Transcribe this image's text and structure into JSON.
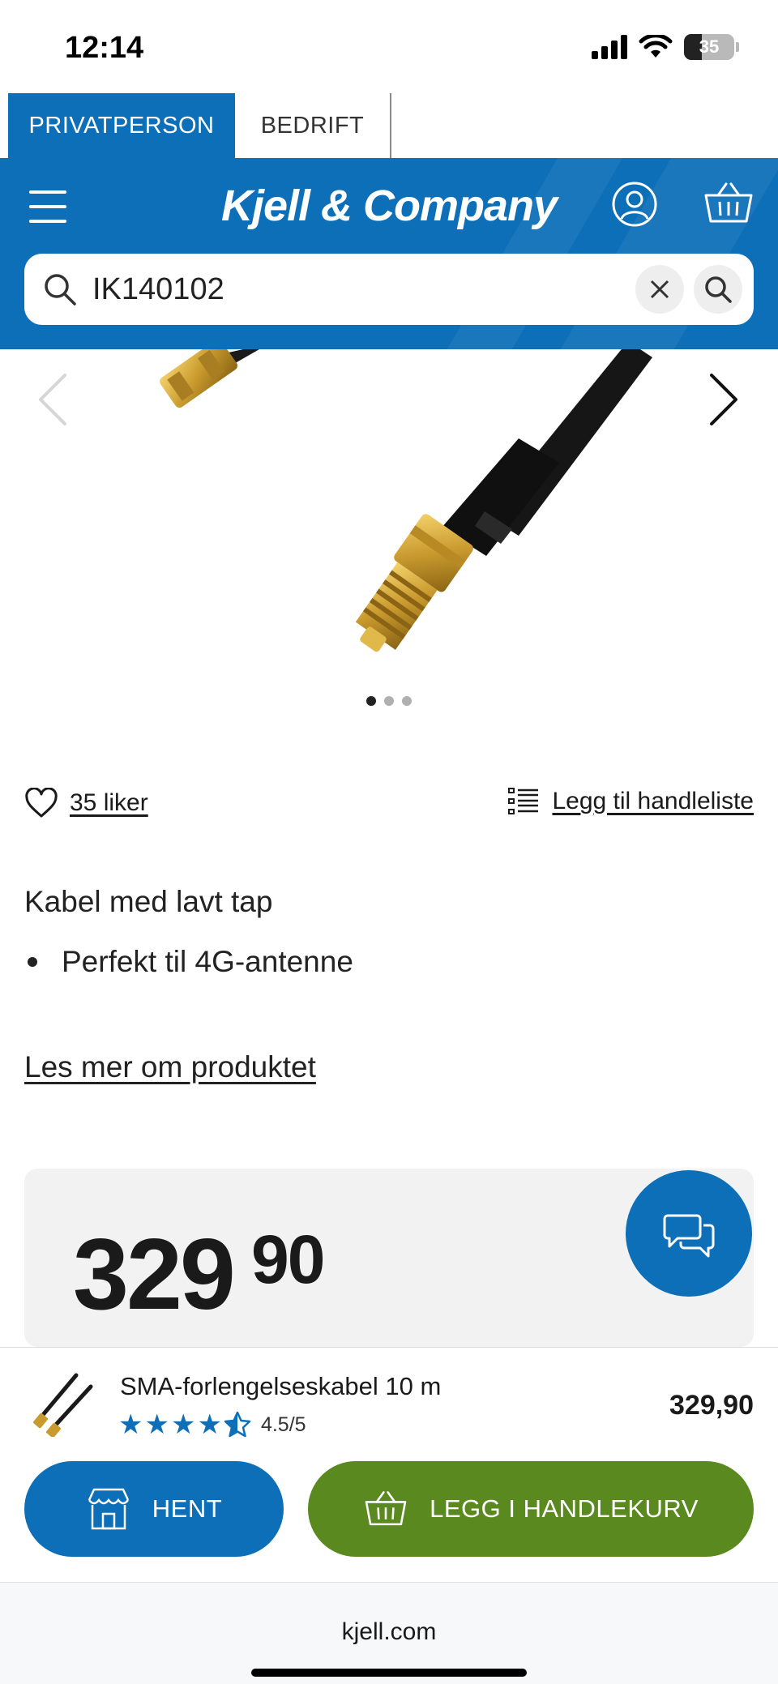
{
  "status_bar": {
    "time": "12:14",
    "battery": "35"
  },
  "segments": {
    "private": "PRIVATPERSON",
    "business": "BEDRIFT"
  },
  "header": {
    "logo": "Kjell & Company",
    "brand_color": "#0d6fb8"
  },
  "search": {
    "value": "IK140102"
  },
  "gallery": {
    "image_count": 3,
    "active_index": 0
  },
  "actions": {
    "likes": "35 liker",
    "shopping_list": "Legg til handleliste"
  },
  "description": {
    "summary": "Kabel med lavt tap",
    "bullets": [
      "Perfekt til 4G-antenne"
    ],
    "read_more": "Les mer om produktet"
  },
  "price": {
    "main": "329",
    "decimals": "90"
  },
  "sticky": {
    "product_name": "SMA-forlengelseskabel 10 m",
    "rating_text": "4.5/5",
    "rating_value": 4.5,
    "price": "329,90",
    "pickup_label": "HENT",
    "add_to_cart_label": "LEGG I HANDLEKURV",
    "cart_color": "#59891f"
  },
  "browser": {
    "url": "kjell.com"
  }
}
